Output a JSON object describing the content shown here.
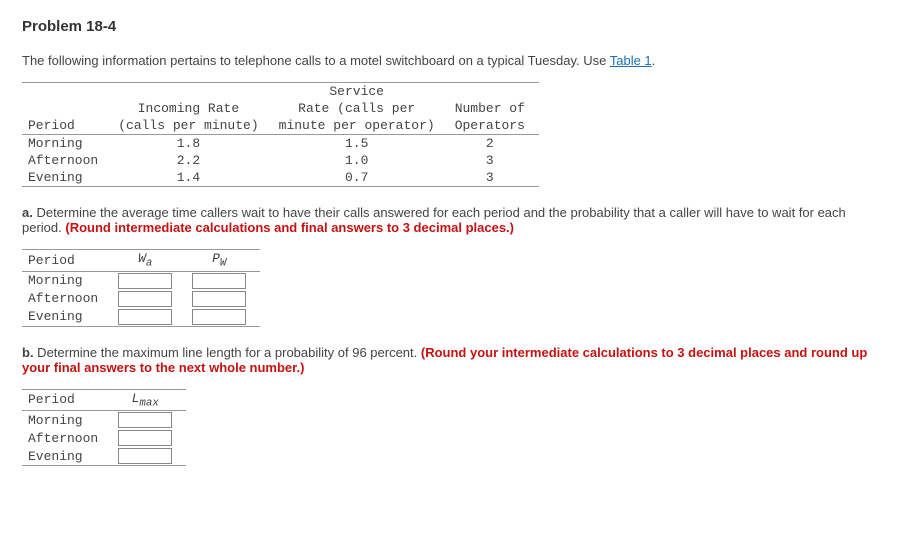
{
  "title": "Problem 18-4",
  "intro_pre": "The following information pertains to telephone calls to a motel switchboard on a typical Tuesday. Use ",
  "intro_link": "Table 1",
  "intro_post": ".",
  "data_table": {
    "headers": {
      "period": "Period",
      "incoming_line1": "Incoming Rate",
      "incoming_line2": "(calls per minute)",
      "service_line0": "Service",
      "service_line1": "Rate (calls per",
      "service_line2": "minute per operator)",
      "ops_line1": "Number of",
      "ops_line2": "Operators"
    },
    "rows": [
      {
        "period": "Morning",
        "incoming": "1.8",
        "service": "1.5",
        "ops": "2"
      },
      {
        "period": "Afternoon",
        "incoming": "2.2",
        "service": "1.0",
        "ops": "3"
      },
      {
        "period": "Evening",
        "incoming": "1.4",
        "service": "0.7",
        "ops": "3"
      }
    ]
  },
  "part_a": {
    "label": "a.",
    "text": " Determine the average time callers wait to have their calls answered for each period and the probability that a caller will have to wait for each period. ",
    "note": "(Round intermediate calculations and final answers to 3 decimal places.)",
    "headers": {
      "period": "Period",
      "wa": "W",
      "wa_sub": "a",
      "pw": "P",
      "pw_sub": "W"
    },
    "rows": [
      "Morning",
      "Afternoon",
      "Evening"
    ]
  },
  "part_b": {
    "label": "b.",
    "text": " Determine the maximum line length for a probability of 96 percent. ",
    "note": "(Round your intermediate calculations to 3 decimal places and round up your final answers to the next whole number.)",
    "headers": {
      "period": "Period",
      "lmax": "L",
      "lmax_sub": "max"
    },
    "rows": [
      "Morning",
      "Afternoon",
      "Evening"
    ]
  }
}
